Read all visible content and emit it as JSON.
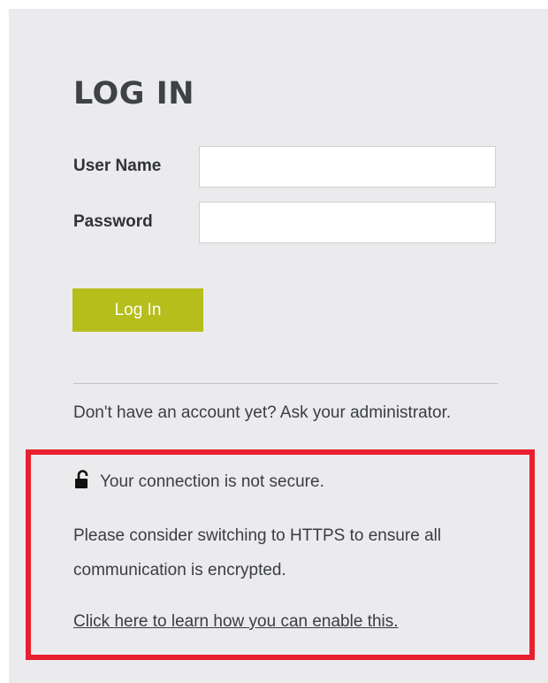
{
  "login": {
    "title": "LOG IN",
    "username_label": "User Name",
    "username_value": "",
    "password_label": "Password",
    "password_value": "",
    "submit_label": "Log In",
    "account_note": "Don't have an account yet? Ask your administrator."
  },
  "security_notice": {
    "icon": "unlocked-padlock-icon",
    "headline": "Your connection is not secure.",
    "advice": "Please consider switching to HTTPS to ensure all communication is encrypted.",
    "link_text": "Click here to learn how you can enable this.",
    "highlight_color": "#e8202e"
  },
  "colors": {
    "panel_background": "#ebebed",
    "button_accent": "#b6be1c",
    "text": "#3a3d41"
  }
}
